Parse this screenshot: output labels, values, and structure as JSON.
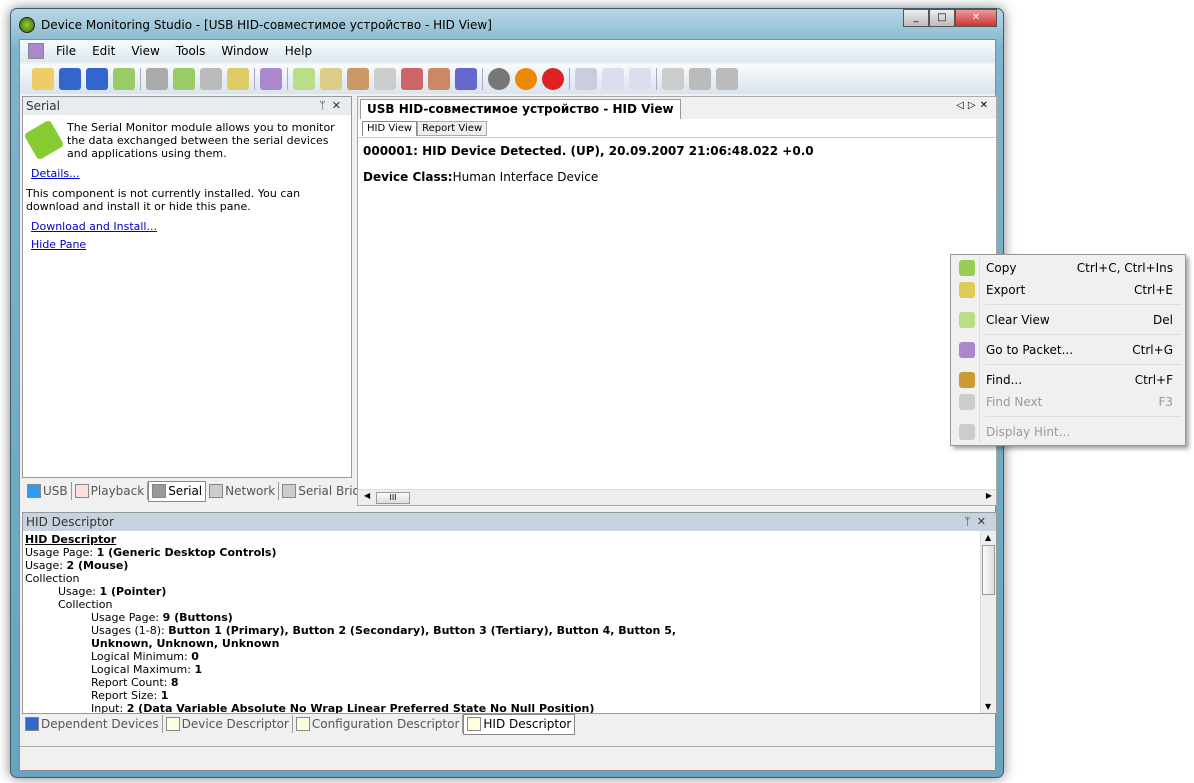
{
  "window": {
    "title": "Device Monitoring Studio - [USB HID-совместимое устройство - HID View]"
  },
  "menu": [
    "File",
    "Edit",
    "View",
    "Tools",
    "Window",
    "Help"
  ],
  "serial_pane": {
    "title": "Serial",
    "description": "The Serial Monitor module allows you to monitor the data exchanged between the serial devices and applications using them.",
    "details_link": "Details...",
    "not_installed": "This component is not currently installed. You can download and install it or hide this pane.",
    "download_link": "Download and Install...",
    "hide_link": "Hide Pane"
  },
  "left_tabs": [
    "USB",
    "Playback",
    "Serial",
    "Network",
    "Serial Bridge"
  ],
  "doc": {
    "title": "USB HID-совместимое устройство - HID View",
    "tabs": [
      "HID View",
      "Report View"
    ],
    "line1": "000001: HID Device Detected. (UP), 20.09.2007 21:06:48.022 +0.0",
    "class_label": "Device Class:",
    "class_value": "Human Interface Device"
  },
  "descriptor_pane": {
    "title": "HID Descriptor",
    "heading": "HID Descriptor",
    "lines": [
      {
        "indent": 0,
        "label": "Usage Page: ",
        "value": "1 (Generic Desktop Controls)"
      },
      {
        "indent": 0,
        "label": "Usage: ",
        "value": "2 (Mouse)"
      },
      {
        "indent": 0,
        "label": "Collection",
        "value": ""
      },
      {
        "indent": 1,
        "label": "Usage: ",
        "value": "1 (Pointer)"
      },
      {
        "indent": 1,
        "label": "Collection",
        "value": ""
      },
      {
        "indent": 2,
        "label": "Usage Page: ",
        "value": "9 (Buttons)"
      },
      {
        "indent": 2,
        "label": "Usages (1-8): ",
        "value": "Button 1 (Primary), Button 2 (Secondary), Button 3 (Tertiary), Button 4, Button 5,"
      },
      {
        "indent": 2,
        "label": "",
        "value": "Unknown, Unknown, Unknown"
      },
      {
        "indent": 2,
        "label": "Logical Minimum: ",
        "value": "0"
      },
      {
        "indent": 2,
        "label": "Logical Maximum: ",
        "value": "1"
      },
      {
        "indent": 2,
        "label": "Report Count: ",
        "value": "8"
      },
      {
        "indent": 2,
        "label": "Report Size: ",
        "value": "1"
      },
      {
        "indent": 2,
        "label": "Input: ",
        "value": "2 (Data Variable Absolute No Wrap Linear Preferred State No Null Position)"
      }
    ]
  },
  "bottom_tabs": [
    "Dependent Devices",
    "Device Descriptor",
    "Configuration Descriptor",
    "HID Descriptor"
  ],
  "context_menu": [
    {
      "label": "Copy",
      "shortcut": "Ctrl+C, Ctrl+Ins",
      "enabled": true,
      "icon": "copy-icon"
    },
    {
      "label": "Export",
      "shortcut": "Ctrl+E",
      "enabled": true,
      "icon": "export-icon"
    },
    {
      "label": "Clear View",
      "shortcut": "Del",
      "enabled": true,
      "icon": "clear-icon"
    },
    {
      "label": "Go to Packet...",
      "shortcut": "Ctrl+G",
      "enabled": true,
      "icon": "goto-icon"
    },
    {
      "label": "Find...",
      "shortcut": "Ctrl+F",
      "enabled": true,
      "icon": "find-icon"
    },
    {
      "label": "Find Next",
      "shortcut": "F3",
      "enabled": false,
      "icon": "find-next-icon"
    },
    {
      "label": "Display Hint...",
      "shortcut": "",
      "enabled": false,
      "icon": "hint-icon"
    }
  ]
}
